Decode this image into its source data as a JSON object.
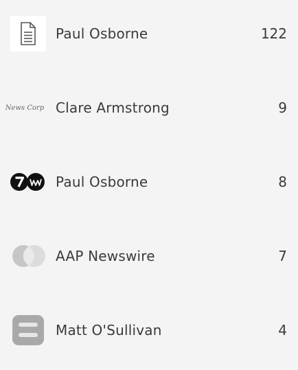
{
  "rows": [
    {
      "logo": "document-icon",
      "name": "Paul Osborne",
      "count": "122"
    },
    {
      "logo": "newscorp-logo",
      "logo_text": "News Corp",
      "name": "Clare Armstrong",
      "count": "9"
    },
    {
      "logo": "seven-west-media-logo",
      "name": "Paul Osborne",
      "count": "8"
    },
    {
      "logo": "aap-logo",
      "name": "AAP Newswire",
      "count": "7"
    },
    {
      "logo": "grey-tile-logo",
      "name": "Matt O'Sullivan",
      "count": "4"
    }
  ]
}
